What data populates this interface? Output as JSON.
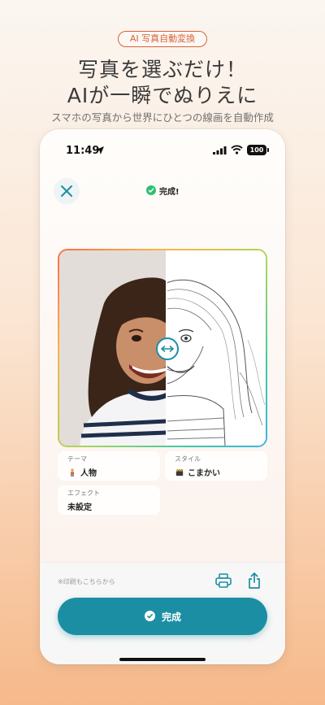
{
  "promo": {
    "badge": "AI 写真自動変換",
    "headline_line1": "写真を選ぶだけ！",
    "headline_line2": "AIが一瞬でぬりえに",
    "subline": "スマホの写真から世界にひとつの線画を自動作成"
  },
  "status_bar": {
    "time": "11:49",
    "battery": "100"
  },
  "header": {
    "status_label": "完成!"
  },
  "options": {
    "theme": {
      "label": "テーマ",
      "value": "人物",
      "icon": "person-icon"
    },
    "style": {
      "label": "スタイル",
      "value": "こまかい",
      "icon": "clapper-icon"
    },
    "effect": {
      "label": "エフェクト",
      "value": "未設定"
    }
  },
  "footer": {
    "print_hint": "※印刷もこちらから",
    "complete_label": "完成"
  },
  "colors": {
    "accent": "#1c8ea3",
    "badge": "#d8613a",
    "success": "#2fbf71"
  }
}
